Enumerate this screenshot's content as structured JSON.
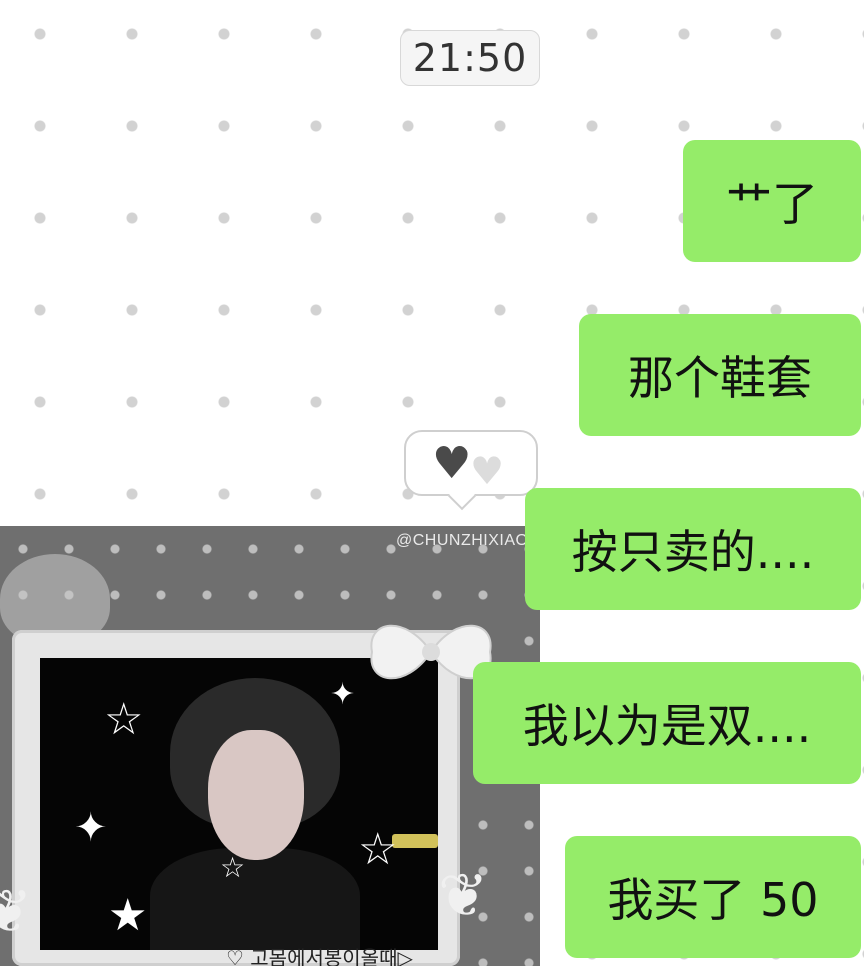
{
  "timestamp": "21:50",
  "messages": [
    {
      "text": "艹了"
    },
    {
      "text": "那个鞋套"
    },
    {
      "text": "按只卖的...."
    },
    {
      "text": "我以为是双...."
    },
    {
      "text": "我买了 50"
    }
  ],
  "photo": {
    "watermark": "@CHUNZHIXIAO",
    "caption": "♡ 고몸에서봉이올때▷"
  },
  "reaction": {
    "icons": [
      "black-heart-icon",
      "white-heart-icon"
    ]
  },
  "colors": {
    "outgoing_bubble": "#95ec69",
    "background": "#ffffff",
    "dot": "#d2d2d2"
  }
}
